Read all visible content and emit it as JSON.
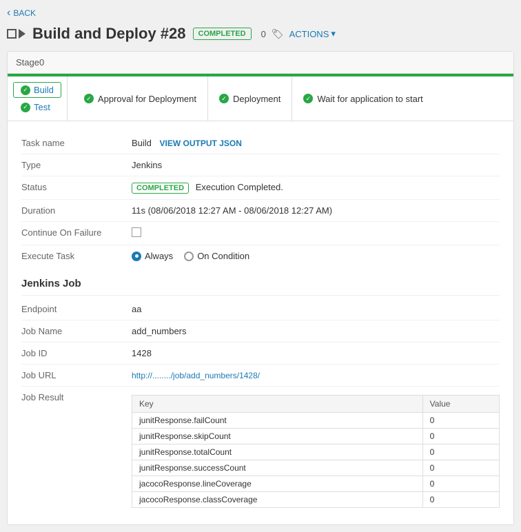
{
  "back": {
    "label": "BACK"
  },
  "header": {
    "title": "Build and Deploy #28",
    "badge": "COMPLETED",
    "zero_label": "0",
    "actions_label": "ACTIONS"
  },
  "stage": {
    "name": "Stage0"
  },
  "left_tabs": [
    {
      "label": "Build",
      "active": true
    },
    {
      "label": "Test",
      "active": false
    }
  ],
  "pipeline_steps": [
    {
      "label": "Approval for Deployment"
    },
    {
      "label": "Deployment"
    },
    {
      "label": "Wait for application to start"
    }
  ],
  "details": {
    "task_name_label": "Task name",
    "task_name_value": "Build",
    "view_output_label": "VIEW OUTPUT JSON",
    "type_label": "Type",
    "type_value": "Jenkins",
    "status_label": "Status",
    "status_badge": "COMPLETED",
    "status_text": "Execution Completed.",
    "duration_label": "Duration",
    "duration_value": "11s (08/06/2018 12:27 AM - 08/06/2018 12:27 AM)",
    "continue_failure_label": "Continue On Failure",
    "execute_task_label": "Execute Task",
    "always_label": "Always",
    "on_condition_label": "On Condition"
  },
  "jenkins": {
    "section_title": "Jenkins Job",
    "endpoint_label": "Endpoint",
    "endpoint_value": "aa",
    "job_name_label": "Job Name",
    "job_name_value": "add_numbers",
    "job_id_label": "Job ID",
    "job_id_value": "1428",
    "job_url_label": "Job URL",
    "job_url_value": "http://......../job/add_numbers/1428/",
    "job_result_label": "Job Result",
    "table_headers": [
      "Key",
      "Value"
    ],
    "table_rows": [
      {
        "key": "junitResponse.failCount",
        "value": "0"
      },
      {
        "key": "junitResponse.skipCount",
        "value": "0"
      },
      {
        "key": "junitResponse.totalCount",
        "value": "0"
      },
      {
        "key": "junitResponse.successCount",
        "value": "0"
      },
      {
        "key": "jacocoResponse.lineCoverage",
        "value": "0"
      },
      {
        "key": "jacocoResponse.classCoverage",
        "value": "0"
      }
    ]
  }
}
